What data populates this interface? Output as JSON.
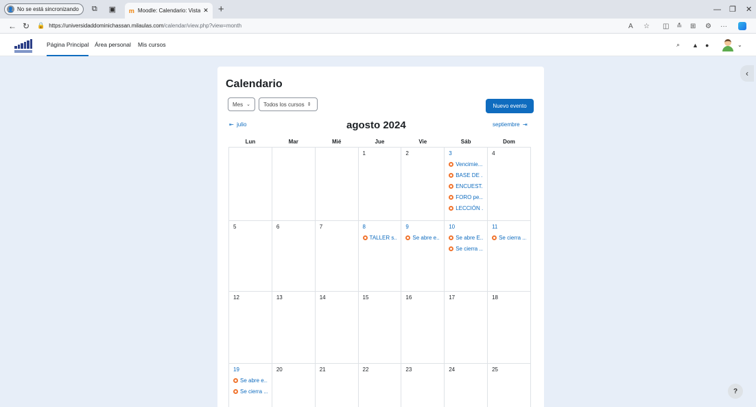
{
  "browser": {
    "sync_label": "No se está sincronizando",
    "tab_title": "Moodle: Calendario: Vista mens…",
    "url_host": "https://universidaddominichassan.milaulas.com",
    "url_path": "/calendar/view.php?view=month"
  },
  "nav": {
    "home": "Página Principal",
    "dashboard": "Área personal",
    "mycourses": "Mis cursos"
  },
  "calendar": {
    "title": "Calendario",
    "view_select": "Mes",
    "course_select": "Todos los cursos",
    "new_event": "Nuevo evento",
    "prev_month": "julio",
    "next_month": "septiembre",
    "month_title": "agosto 2024",
    "weekdays": [
      "Lun",
      "Mar",
      "Mié",
      "Jue",
      "Vie",
      "Sáb",
      "Dom"
    ],
    "weeks": [
      [
        {
          "day": ""
        },
        {
          "day": ""
        },
        {
          "day": ""
        },
        {
          "day": "1"
        },
        {
          "day": "2"
        },
        {
          "day": "3",
          "link": true,
          "events": [
            "Vencimie...",
            "BASE DE ...",
            "ENCUEST...",
            "FORO pe...",
            "LECCIÓN ..."
          ]
        },
        {
          "day": "4"
        }
      ],
      [
        {
          "day": "5"
        },
        {
          "day": "6"
        },
        {
          "day": "7"
        },
        {
          "day": "8",
          "link": true,
          "events": [
            "TALLER s..."
          ]
        },
        {
          "day": "9",
          "link": true,
          "events": [
            "Se abre e..."
          ]
        },
        {
          "day": "10",
          "link": true,
          "events": [
            "Se abre E...",
            "Se cierra ..."
          ]
        },
        {
          "day": "11",
          "link": true,
          "events": [
            "Se cierra ..."
          ]
        }
      ],
      [
        {
          "day": "12"
        },
        {
          "day": "13"
        },
        {
          "day": "14"
        },
        {
          "day": "15"
        },
        {
          "day": "16"
        },
        {
          "day": "17"
        },
        {
          "day": "18"
        }
      ],
      [
        {
          "day": "19",
          "link": true,
          "events": [
            "Se abre e...",
            "Se cierra ..."
          ]
        },
        {
          "day": "20"
        },
        {
          "day": "21"
        },
        {
          "day": "22"
        },
        {
          "day": "23"
        },
        {
          "day": "24"
        },
        {
          "day": "25"
        }
      ]
    ]
  },
  "help": "?",
  "colors": {
    "primary": "#0f6cbf",
    "event_dot": "#f0742e",
    "page_bg": "#e7eef8"
  }
}
